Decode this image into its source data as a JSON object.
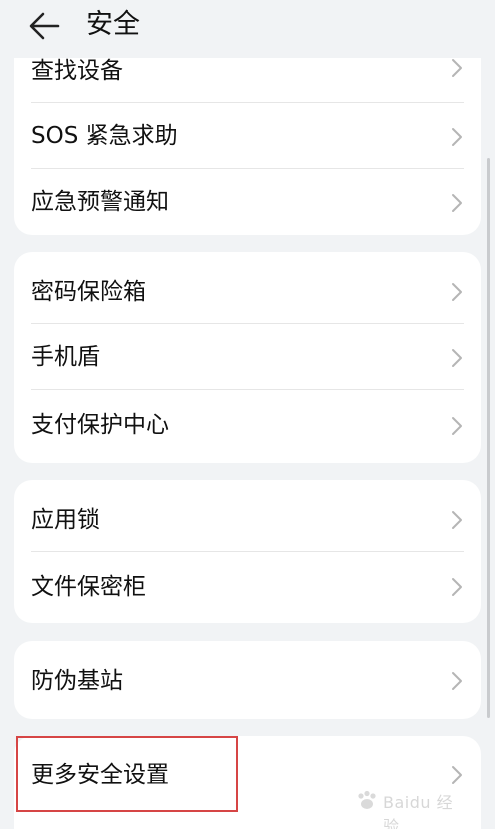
{
  "header": {
    "title": "安全",
    "back_icon": "arrow-left-icon"
  },
  "groups": [
    {
      "items": [
        {
          "label": "查找设备"
        },
        {
          "label": "SOS 紧急求助"
        },
        {
          "label": "应急预警通知"
        }
      ]
    },
    {
      "items": [
        {
          "label": "密码保险箱"
        },
        {
          "label": "手机盾"
        },
        {
          "label": "支付保护中心"
        }
      ]
    },
    {
      "items": [
        {
          "label": "应用锁"
        },
        {
          "label": "文件保密柜"
        }
      ]
    },
    {
      "items": [
        {
          "label": "防伪基站"
        }
      ]
    },
    {
      "items": [
        {
          "label": "更多安全设置"
        }
      ]
    }
  ],
  "annotation": {
    "highlight_color": "#d64545",
    "highlight_target": "更多安全设置"
  },
  "watermark": {
    "text": "Baidu 经验"
  },
  "colors": {
    "background": "#f1f3f5",
    "card": "#ffffff",
    "text": "#111111",
    "chevron": "#b5b5b5"
  }
}
